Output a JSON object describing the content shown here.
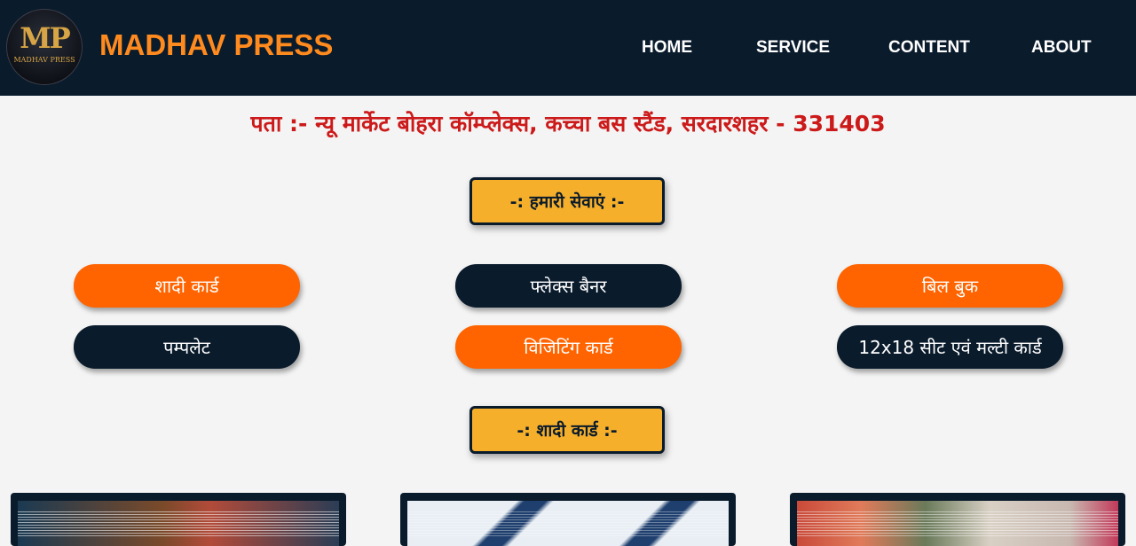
{
  "header": {
    "logo": {
      "monogram": "MP",
      "subtitle": "MADHAV PRESS"
    },
    "brand": "MADHAV PRESS",
    "nav": [
      "HOME",
      "SERVICE",
      "CONTENT",
      "ABOUT"
    ]
  },
  "address": "पता :- न्यू मार्केट बोहरा कॉम्प्लेक्स, कच्चा बस स्टैंड, सरदारशहर - 331403",
  "services_heading": "-: हमारी सेवाएं :-",
  "services": [
    "शादी कार्ड",
    "फ्लेक्स बैनर",
    "बिल बुक",
    "पम्पलेट",
    "विजिटिंग कार्ड",
    "12x18 सीट एवं मल्टी कार्ड"
  ],
  "wedding_heading": "-: शादी कार्ड :-",
  "colors": {
    "header_bg": "#0a1b2c",
    "brand": "#ff8a1e",
    "accent_orange": "#ff6400",
    "heading_box": "#f5af2b",
    "address": "#cc1a1a"
  }
}
